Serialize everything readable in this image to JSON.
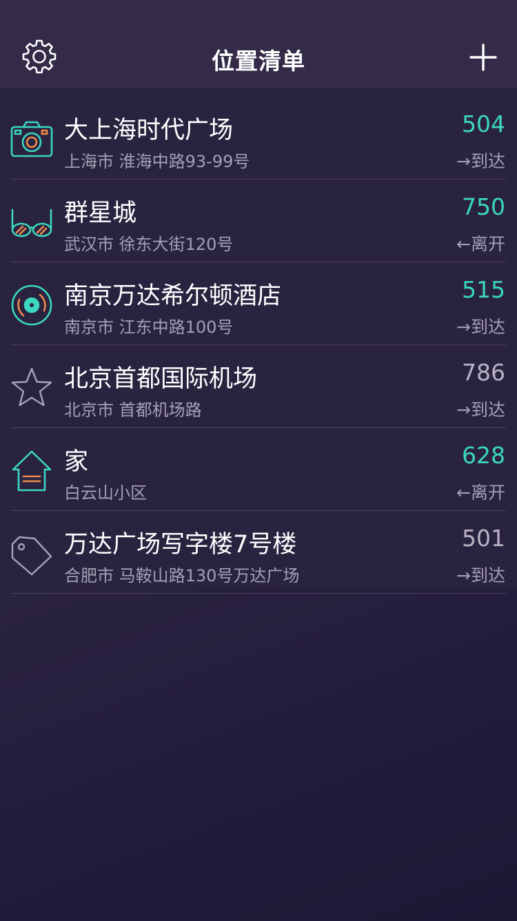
{
  "header": {
    "title": "位置清单",
    "settings_icon": "gear-icon",
    "add_icon": "plus-icon"
  },
  "colors": {
    "accent": "#3bd7bf",
    "icon_orange": "#f08a4b",
    "muted_icon": "#a8a2b6",
    "nav_bg": "#332b48",
    "list_bg": "#2a2340"
  },
  "locations": [
    {
      "name": "大上海时代广场",
      "address": "上海市 淮海中路93-99号",
      "count": "504",
      "direction": "→到达",
      "icon": "camera-icon",
      "highlighted": true
    },
    {
      "name": "群星城",
      "address": "武汉市 徐东大街120号",
      "count": "750",
      "direction": "←离开",
      "icon": "glasses-icon",
      "highlighted": true
    },
    {
      "name": "南京万达希尔顿酒店",
      "address": "南京市 江东中路100号",
      "count": "515",
      "direction": "→到达",
      "icon": "vinyl-record-icon",
      "highlighted": true
    },
    {
      "name": "北京首都国际机场",
      "address": "北京市 首都机场路",
      "count": "786",
      "direction": "→到达",
      "icon": "star-icon",
      "highlighted": false
    },
    {
      "name": "家",
      "address": "白云山小区",
      "count": "628",
      "direction": "←离开",
      "icon": "home-icon",
      "highlighted": true
    },
    {
      "name": "万达广场写字楼7号楼",
      "address": "合肥市 马鞍山路130号万达广场",
      "count": "501",
      "direction": "→到达",
      "icon": "tag-icon",
      "highlighted": false
    }
  ]
}
